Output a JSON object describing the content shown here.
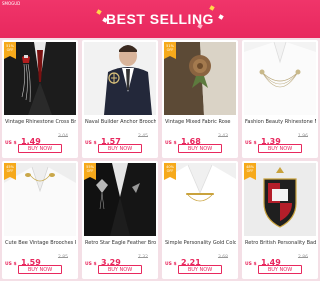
{
  "header": {
    "brand": "SMOGUD",
    "title": "BEST SELLING"
  },
  "products": [
    {
      "discount": "51% OFF",
      "name": "Vintage Rhinestone Cross Brooch",
      "currency": "US $",
      "price": "1.49",
      "old_price": "3.04",
      "buy_label": "BUY NOW",
      "image": "black-suit-rhinestone-cross-brooch"
    },
    {
      "discount": "",
      "name": "Naval Builder Anchor Brooches",
      "currency": "US $",
      "price": "1.57",
      "old_price": "2.45",
      "buy_label": "BUY NOW",
      "image": "man-in-suit-anchor-brooch"
    },
    {
      "discount": "51% OFF",
      "name": "Vintage Mixed Fabric Rose",
      "currency": "US $",
      "price": "1.68",
      "old_price": "3.43",
      "buy_label": "BUY NOW",
      "image": "fabric-rose-lapel-pin"
    },
    {
      "discount": "",
      "name": "Fashion Beauty Rhinestone Men",
      "currency": "US $",
      "price": "1.39",
      "old_price": "1.96",
      "buy_label": "BUY NOW",
      "image": "white-shirt-chain-brooch"
    },
    {
      "discount": "45% OFF",
      "name": "Cute Bee Vintage Brooches Pins",
      "currency": "US $",
      "price": "1.59",
      "old_price": "2.85",
      "buy_label": "BUY NOW",
      "image": "white-collar-bee-pins"
    },
    {
      "discount": "55% OFF",
      "name": "Retro Star Eagle Feather Brooch",
      "currency": "US $",
      "price": "3.29",
      "old_price": "7.32",
      "buy_label": "BUY NOW",
      "image": "black-suit-eagle-feather-brooch"
    },
    {
      "discount": "40% OFF",
      "name": "Simple Personality Gold Color",
      "currency": "US $",
      "price": "2.21",
      "old_price": "3.68",
      "buy_label": "BUY NOW",
      "image": "white-collar-gold-chain-pin"
    },
    {
      "discount": "48% OFF",
      "name": "Retro British Personality Badge",
      "currency": "US $",
      "price": "1.49",
      "old_price": "2.86",
      "buy_label": "BUY NOW",
      "image": "british-crest-badge"
    }
  ],
  "colors": {
    "accent": "#e8285e",
    "discount_badge": "#f6a91b",
    "page_bg": "#f4dfe6"
  }
}
